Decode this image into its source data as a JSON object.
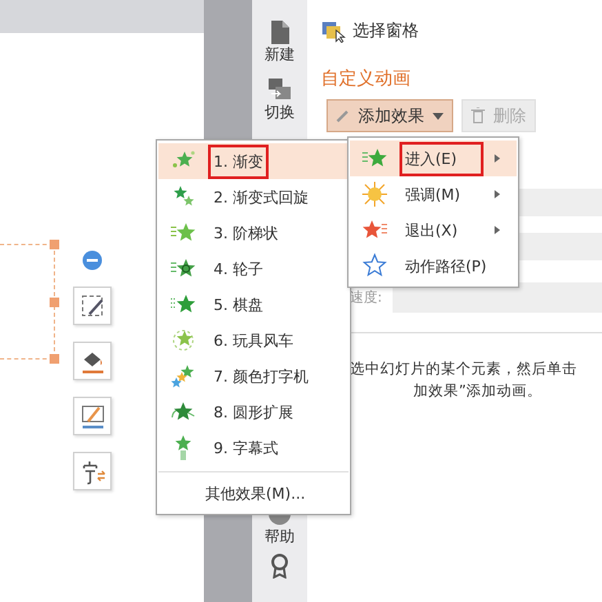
{
  "sidebar": {
    "items": [
      {
        "label": "新建",
        "kind": "new"
      },
      {
        "label": "切换",
        "kind": "switch"
      },
      {
        "label": "帮助",
        "kind": "help"
      },
      {
        "kind": "award"
      }
    ]
  },
  "panel": {
    "select_pane": "选择窗格",
    "title": "自定义动画",
    "add_button": {
      "label": "添加效果",
      "selected": true
    },
    "delete_button": {
      "label": "删除",
      "disabled": true
    },
    "speed_label": "速度:",
    "hint": [
      "选中幻灯片的某个元素，然后单击",
      "加效果”添加动画。"
    ]
  },
  "effects_menu": {
    "items": [
      {
        "label": "1. 渐变",
        "selected": true,
        "highlighted": true,
        "kind": "fade"
      },
      {
        "label": "2. 渐变式回旋",
        "selected": false,
        "highlighted": false,
        "kind": "spin"
      },
      {
        "label": "3. 阶梯状",
        "selected": false,
        "highlighted": false,
        "kind": "steps"
      },
      {
        "label": "4. 轮子",
        "selected": false,
        "highlighted": false,
        "kind": "wheel"
      },
      {
        "label": "5. 棋盘",
        "selected": false,
        "highlighted": false,
        "kind": "checker"
      },
      {
        "label": "6. 玩具风车",
        "selected": false,
        "highlighted": false,
        "kind": "pinwheel"
      },
      {
        "label": "7. 颜色打字机",
        "selected": false,
        "highlighted": false,
        "kind": "typewriter"
      },
      {
        "label": "8. 圆形扩展",
        "selected": false,
        "highlighted": false,
        "kind": "circle"
      },
      {
        "label": "9. 字幕式",
        "selected": false,
        "highlighted": false,
        "kind": "credits"
      }
    ],
    "more": "其他效果(M)..."
  },
  "category_menu": {
    "items": [
      {
        "label": "进入(E)",
        "selected": true,
        "highlighted": true,
        "kind": "entrance"
      },
      {
        "label": "强调(M)",
        "selected": false,
        "highlighted": false,
        "kind": "emphasis"
      },
      {
        "label": "退出(X)",
        "selected": false,
        "highlighted": false,
        "kind": "exit"
      },
      {
        "label": "动作路径(P)",
        "selected": false,
        "highlighted": false,
        "kind": "path"
      }
    ]
  }
}
